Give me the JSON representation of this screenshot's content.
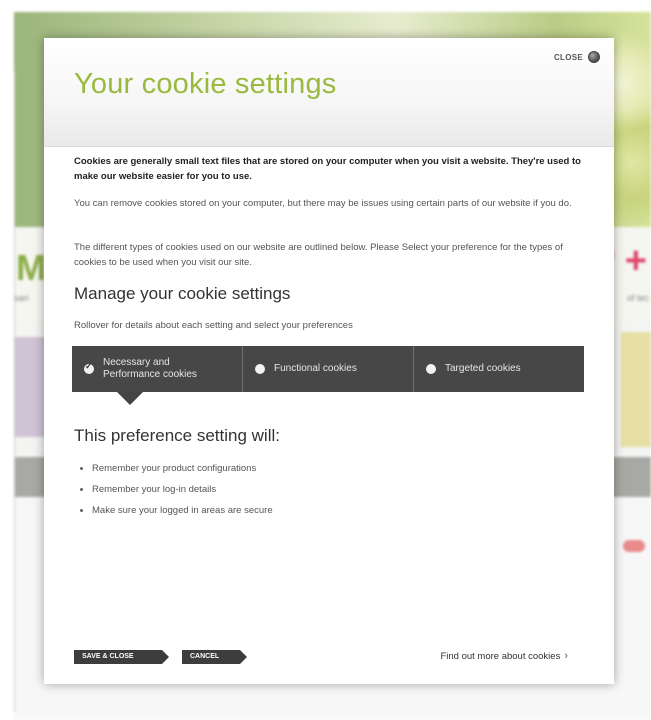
{
  "background": {
    "left_fragment": "M",
    "right_fragment": "P +",
    "left_small": "sari",
    "right_small": "of tec"
  },
  "modal": {
    "title": "Your cookie settings",
    "close_label": "CLOSE",
    "intro_strong": "Cookies are generally small text files that are stored on your computer when you visit a website. They're used to make our website easier for you to use.",
    "para1": "You can remove cookies stored on your computer, but there may be issues using certain parts of our website if you do.",
    "para2": "The different types of cookies used on our website are outlined below. Please Select your preference for the types of cookies to be used when you visit our site.",
    "manage_title": "Manage your cookie settings",
    "rollover_text": "Rollover for details about each setting and select your preferences",
    "tabs": [
      {
        "label": "Necessary and Performance cookies",
        "selected": true
      },
      {
        "label": "Functional cookies",
        "selected": false
      },
      {
        "label": "Targeted cookies",
        "selected": false
      }
    ],
    "preference_title": "This preference setting will:",
    "preference_items": [
      "Remember your product configurations",
      "Remember your log-in details",
      "Make sure your logged in areas are secure"
    ],
    "save_label": "SAVE & CLOSE",
    "cancel_label": "CANCEL",
    "find_more_label": "Find out more about cookies",
    "find_more_icon": "chevron-right-icon",
    "close_icon": "close-circle-icon",
    "accent_color": "#9aba3f",
    "tab_color": "#444444"
  }
}
